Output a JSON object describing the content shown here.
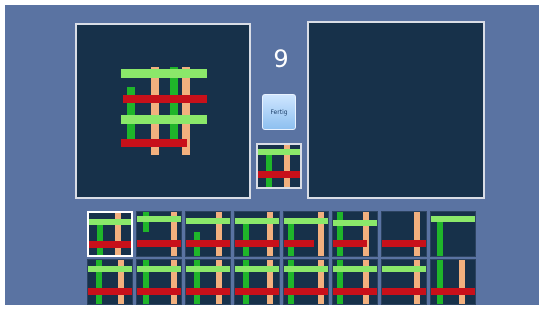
{
  "counter": "9",
  "button_label": "Fertig",
  "colors": {
    "background": "#5a73a2",
    "panel": "#17314a",
    "light_green": "#8be86a",
    "green": "#1fb52a",
    "red": "#c8101a",
    "tan": "#f2b07e",
    "border": "#d9dde6"
  },
  "tile_rows": [
    [
      "tile-1",
      "tile-2",
      "tile-3",
      "tile-4",
      "tile-5",
      "tile-6",
      "tile-7",
      "tile-8"
    ],
    [
      "tile-9",
      "tile-10",
      "tile-11",
      "tile-12",
      "tile-13",
      "tile-14",
      "tile-15",
      "tile-16"
    ]
  ],
  "selected_tile": "tile-1"
}
